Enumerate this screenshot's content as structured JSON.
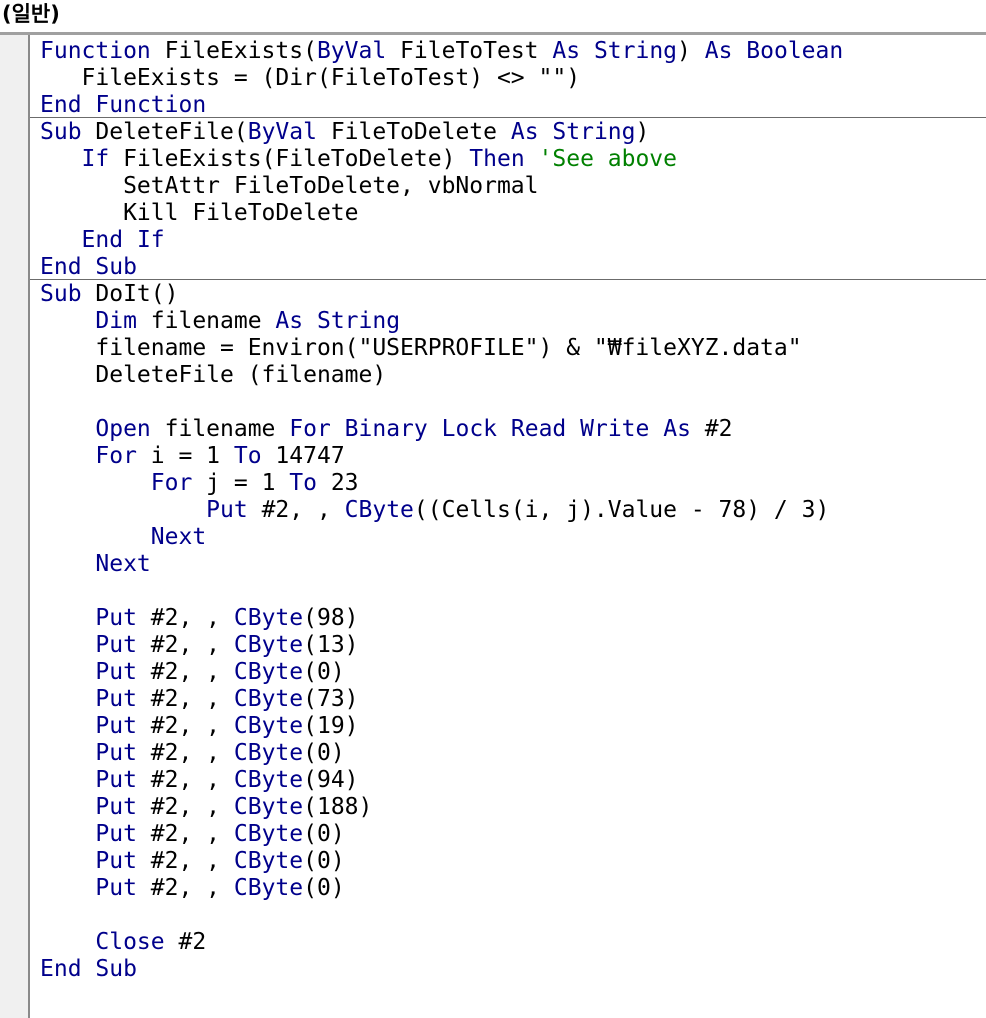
{
  "header": {
    "section_title": "(일반)"
  },
  "colors": {
    "keyword": "#00008b",
    "comment": "#008000",
    "text": "#000000"
  },
  "code_lines": [
    [
      {
        "t": "Function",
        "k": "kw"
      },
      {
        "t": " FileExists(",
        "k": "tx"
      },
      {
        "t": "ByVal",
        "k": "kw"
      },
      {
        "t": " FileToTest ",
        "k": "tx"
      },
      {
        "t": "As",
        "k": "kw"
      },
      {
        "t": " ",
        "k": "tx"
      },
      {
        "t": "String",
        "k": "kw"
      },
      {
        "t": ") ",
        "k": "tx"
      },
      {
        "t": "As",
        "k": "kw"
      },
      {
        "t": " ",
        "k": "tx"
      },
      {
        "t": "Boolean",
        "k": "kw"
      }
    ],
    [
      {
        "t": "   FileExists = (Dir(FileToTest) <> \"\")",
        "k": "tx"
      }
    ],
    [
      {
        "t": "End",
        "k": "kw"
      },
      {
        "t": " ",
        "k": "tx"
      },
      {
        "t": "Function",
        "k": "kw"
      }
    ],
    [
      {
        "t": "Sub",
        "k": "kw"
      },
      {
        "t": " DeleteFile(",
        "k": "tx"
      },
      {
        "t": "ByVal",
        "k": "kw"
      },
      {
        "t": " FileToDelete ",
        "k": "tx"
      },
      {
        "t": "As",
        "k": "kw"
      },
      {
        "t": " ",
        "k": "tx"
      },
      {
        "t": "String",
        "k": "kw"
      },
      {
        "t": ")",
        "k": "tx"
      }
    ],
    [
      {
        "t": "   ",
        "k": "tx"
      },
      {
        "t": "If",
        "k": "kw"
      },
      {
        "t": " FileExists(FileToDelete) ",
        "k": "tx"
      },
      {
        "t": "Then",
        "k": "kw"
      },
      {
        "t": " ",
        "k": "tx"
      },
      {
        "t": "'See above",
        "k": "cm"
      }
    ],
    [
      {
        "t": "      SetAttr FileToDelete, vbNormal",
        "k": "tx"
      }
    ],
    [
      {
        "t": "      Kill FileToDelete",
        "k": "tx"
      }
    ],
    [
      {
        "t": "   ",
        "k": "tx"
      },
      {
        "t": "End",
        "k": "kw"
      },
      {
        "t": " ",
        "k": "tx"
      },
      {
        "t": "If",
        "k": "kw"
      }
    ],
    [
      {
        "t": "End",
        "k": "kw"
      },
      {
        "t": " ",
        "k": "tx"
      },
      {
        "t": "Sub",
        "k": "kw"
      }
    ],
    [
      {
        "t": "Sub",
        "k": "kw"
      },
      {
        "t": " DoIt()",
        "k": "tx"
      }
    ],
    [
      {
        "t": "    ",
        "k": "tx"
      },
      {
        "t": "Dim",
        "k": "kw"
      },
      {
        "t": " filename ",
        "k": "tx"
      },
      {
        "t": "As",
        "k": "kw"
      },
      {
        "t": " ",
        "k": "tx"
      },
      {
        "t": "String",
        "k": "kw"
      }
    ],
    [
      {
        "t": "    filename = Environ(\"USERPROFILE\") & \"₩fileXYZ.data\"",
        "k": "tx"
      }
    ],
    [
      {
        "t": "    DeleteFile (filename)",
        "k": "tx"
      }
    ],
    [
      {
        "t": "",
        "k": "tx"
      }
    ],
    [
      {
        "t": "    ",
        "k": "tx"
      },
      {
        "t": "Open",
        "k": "kw"
      },
      {
        "t": " filename ",
        "k": "tx"
      },
      {
        "t": "For",
        "k": "kw"
      },
      {
        "t": " ",
        "k": "tx"
      },
      {
        "t": "Binary",
        "k": "kw"
      },
      {
        "t": " ",
        "k": "tx"
      },
      {
        "t": "Lock",
        "k": "kw"
      },
      {
        "t": " ",
        "k": "tx"
      },
      {
        "t": "Read",
        "k": "kw"
      },
      {
        "t": " ",
        "k": "tx"
      },
      {
        "t": "Write",
        "k": "kw"
      },
      {
        "t": " ",
        "k": "tx"
      },
      {
        "t": "As",
        "k": "kw"
      },
      {
        "t": " #2",
        "k": "tx"
      }
    ],
    [
      {
        "t": "    ",
        "k": "tx"
      },
      {
        "t": "For",
        "k": "kw"
      },
      {
        "t": " i = 1 ",
        "k": "tx"
      },
      {
        "t": "To",
        "k": "kw"
      },
      {
        "t": " 14747",
        "k": "tx"
      }
    ],
    [
      {
        "t": "        ",
        "k": "tx"
      },
      {
        "t": "For",
        "k": "kw"
      },
      {
        "t": " j = 1 ",
        "k": "tx"
      },
      {
        "t": "To",
        "k": "kw"
      },
      {
        "t": " 23",
        "k": "tx"
      }
    ],
    [
      {
        "t": "            ",
        "k": "tx"
      },
      {
        "t": "Put",
        "k": "kw"
      },
      {
        "t": " #2, , ",
        "k": "tx"
      },
      {
        "t": "CByte",
        "k": "kw"
      },
      {
        "t": "((Cells(i, j).Value - 78) / 3)",
        "k": "tx"
      }
    ],
    [
      {
        "t": "        ",
        "k": "tx"
      },
      {
        "t": "Next",
        "k": "kw"
      }
    ],
    [
      {
        "t": "    ",
        "k": "tx"
      },
      {
        "t": "Next",
        "k": "kw"
      }
    ],
    [
      {
        "t": "",
        "k": "tx"
      }
    ],
    [
      {
        "t": "    ",
        "k": "tx"
      },
      {
        "t": "Put",
        "k": "kw"
      },
      {
        "t": " #2, , ",
        "k": "tx"
      },
      {
        "t": "CByte",
        "k": "kw"
      },
      {
        "t": "(98)",
        "k": "tx"
      }
    ],
    [
      {
        "t": "    ",
        "k": "tx"
      },
      {
        "t": "Put",
        "k": "kw"
      },
      {
        "t": " #2, , ",
        "k": "tx"
      },
      {
        "t": "CByte",
        "k": "kw"
      },
      {
        "t": "(13)",
        "k": "tx"
      }
    ],
    [
      {
        "t": "    ",
        "k": "tx"
      },
      {
        "t": "Put",
        "k": "kw"
      },
      {
        "t": " #2, , ",
        "k": "tx"
      },
      {
        "t": "CByte",
        "k": "kw"
      },
      {
        "t": "(0)",
        "k": "tx"
      }
    ],
    [
      {
        "t": "    ",
        "k": "tx"
      },
      {
        "t": "Put",
        "k": "kw"
      },
      {
        "t": " #2, , ",
        "k": "tx"
      },
      {
        "t": "CByte",
        "k": "kw"
      },
      {
        "t": "(73)",
        "k": "tx"
      }
    ],
    [
      {
        "t": "    ",
        "k": "tx"
      },
      {
        "t": "Put",
        "k": "kw"
      },
      {
        "t": " #2, , ",
        "k": "tx"
      },
      {
        "t": "CByte",
        "k": "kw"
      },
      {
        "t": "(19)",
        "k": "tx"
      }
    ],
    [
      {
        "t": "    ",
        "k": "tx"
      },
      {
        "t": "Put",
        "k": "kw"
      },
      {
        "t": " #2, , ",
        "k": "tx"
      },
      {
        "t": "CByte",
        "k": "kw"
      },
      {
        "t": "(0)",
        "k": "tx"
      }
    ],
    [
      {
        "t": "    ",
        "k": "tx"
      },
      {
        "t": "Put",
        "k": "kw"
      },
      {
        "t": " #2, , ",
        "k": "tx"
      },
      {
        "t": "CByte",
        "k": "kw"
      },
      {
        "t": "(94)",
        "k": "tx"
      }
    ],
    [
      {
        "t": "    ",
        "k": "tx"
      },
      {
        "t": "Put",
        "k": "kw"
      },
      {
        "t": " #2, , ",
        "k": "tx"
      },
      {
        "t": "CByte",
        "k": "kw"
      },
      {
        "t": "(188)",
        "k": "tx"
      }
    ],
    [
      {
        "t": "    ",
        "k": "tx"
      },
      {
        "t": "Put",
        "k": "kw"
      },
      {
        "t": " #2, , ",
        "k": "tx"
      },
      {
        "t": "CByte",
        "k": "kw"
      },
      {
        "t": "(0)",
        "k": "tx"
      }
    ],
    [
      {
        "t": "    ",
        "k": "tx"
      },
      {
        "t": "Put",
        "k": "kw"
      },
      {
        "t": " #2, , ",
        "k": "tx"
      },
      {
        "t": "CByte",
        "k": "kw"
      },
      {
        "t": "(0)",
        "k": "tx"
      }
    ],
    [
      {
        "t": "    ",
        "k": "tx"
      },
      {
        "t": "Put",
        "k": "kw"
      },
      {
        "t": " #2, , ",
        "k": "tx"
      },
      {
        "t": "CByte",
        "k": "kw"
      },
      {
        "t": "(0)",
        "k": "tx"
      }
    ],
    [
      {
        "t": "",
        "k": "tx"
      }
    ],
    [
      {
        "t": "    ",
        "k": "tx"
      },
      {
        "t": "Close",
        "k": "kw"
      },
      {
        "t": " #2",
        "k": "tx"
      }
    ],
    [
      {
        "t": "End",
        "k": "kw"
      },
      {
        "t": " ",
        "k": "tx"
      },
      {
        "t": "Sub",
        "k": "kw"
      }
    ]
  ]
}
